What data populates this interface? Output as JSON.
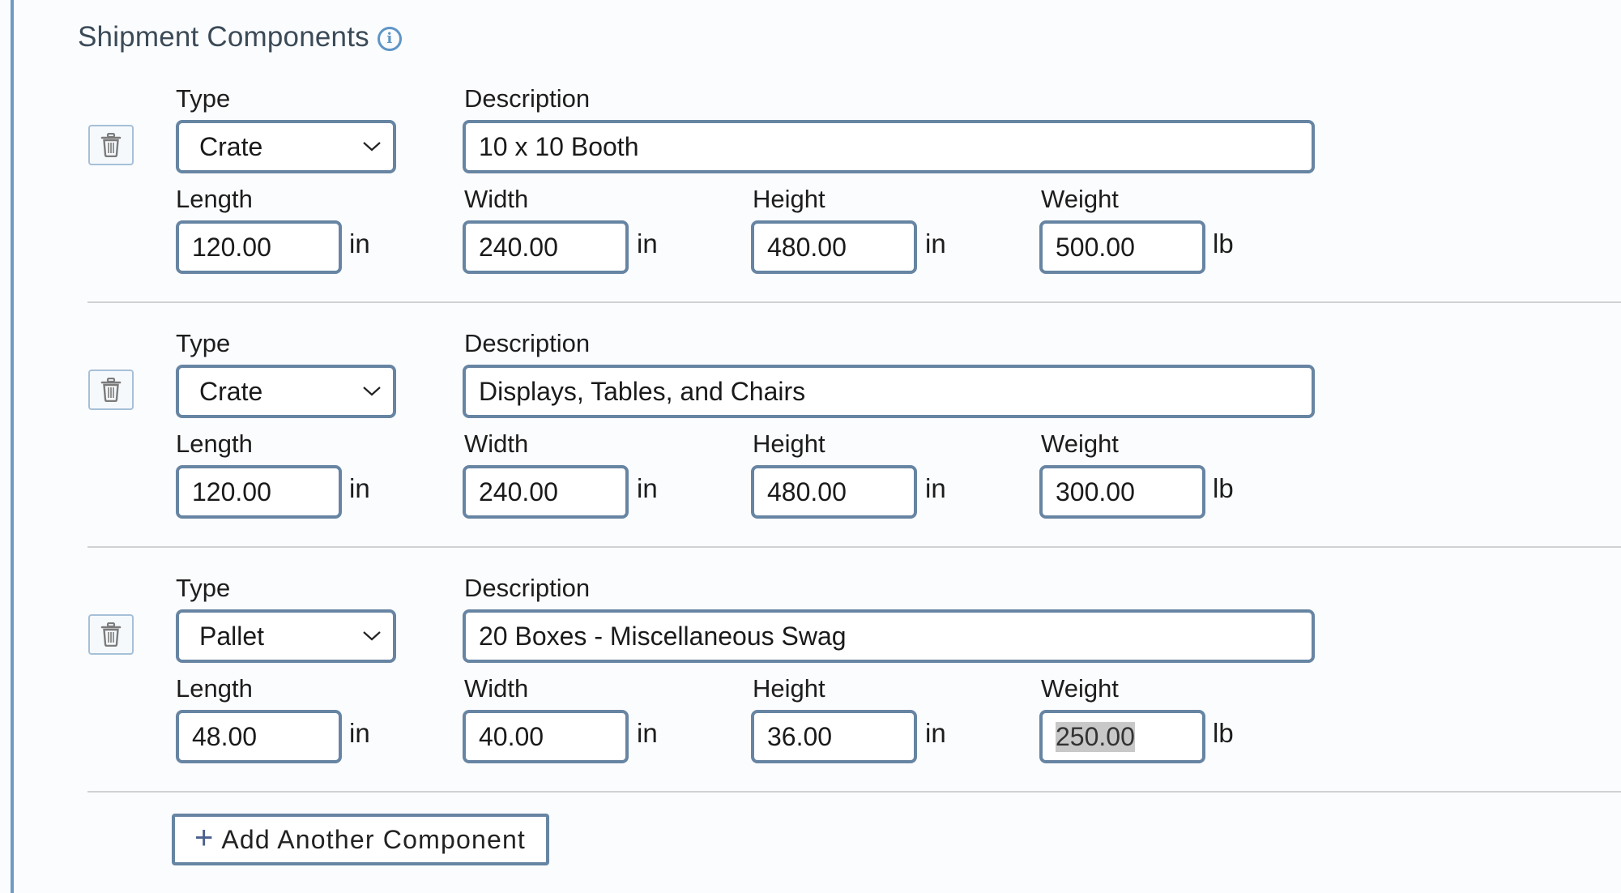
{
  "section": {
    "title": "Shipment Components",
    "info_icon": "info-circle-icon"
  },
  "labels": {
    "type": "Type",
    "description": "Description",
    "length": "Length",
    "width": "Width",
    "height": "Height",
    "weight": "Weight"
  },
  "units": {
    "dimension": "in",
    "weight": "lb"
  },
  "icons": {
    "delete": "trash-icon",
    "dropdown": "chevron-down-icon",
    "add": "plus-icon"
  },
  "components": [
    {
      "type": "Crate",
      "description": "10 x 10 Booth",
      "length": "120.00",
      "width": "240.00",
      "height": "480.00",
      "weight": "500.00"
    },
    {
      "type": "Crate",
      "description": "Displays, Tables, and Chairs",
      "length": "120.00",
      "width": "240.00",
      "height": "480.00",
      "weight": "300.00"
    },
    {
      "type": "Pallet",
      "description": "20 Boxes - Miscellaneous Swag",
      "length": "48.00",
      "width": "40.00",
      "height": "36.00",
      "weight": "250.00",
      "weight_selected": true
    }
  ],
  "add_button": {
    "label": "Add Another Component",
    "icon": "+"
  },
  "colors": {
    "border": "#6785a3",
    "accent": "#5e95c6",
    "left_rule": "#6f9ac6",
    "selection": "#c8c8c8"
  }
}
